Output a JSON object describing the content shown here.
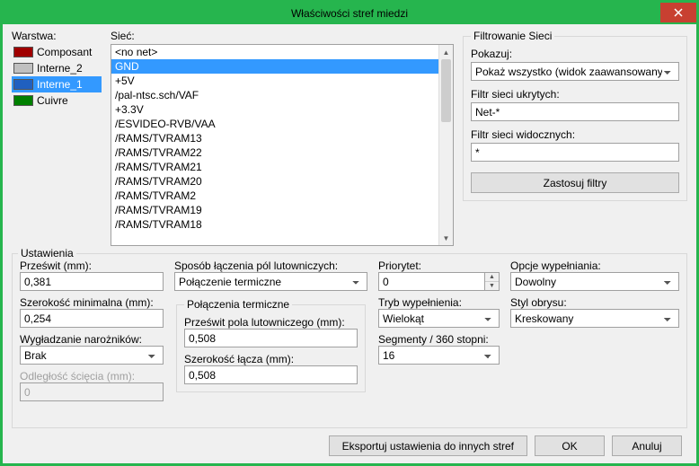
{
  "window": {
    "title": "Właściwości stref miedzi"
  },
  "layers": {
    "label": "Warstwa:",
    "items": [
      {
        "name": "Composant",
        "color": "#a00000",
        "selected": false
      },
      {
        "name": "Interne_2",
        "color": "#c0c0c0",
        "selected": false
      },
      {
        "name": "Interne_1",
        "color": "#2060c0",
        "selected": true
      },
      {
        "name": "Cuivre",
        "color": "#008000",
        "selected": false
      }
    ]
  },
  "nets": {
    "label": "Sieć:",
    "items": [
      "<no net>",
      "GND",
      "+5V",
      "/pal-ntsc.sch/VAF",
      "+3.3V",
      "/ESVIDEO-RVB/VAA",
      "/RAMS/TVRAM13",
      "/RAMS/TVRAM22",
      "/RAMS/TVRAM21",
      "/RAMS/TVRAM20",
      "/RAMS/TVRAM2",
      "/RAMS/TVRAM19",
      "/RAMS/TVRAM18"
    ],
    "selected_index": 1
  },
  "filter": {
    "legend": "Filtrowanie Sieci",
    "show_label": "Pokazuj:",
    "show_value": "Pokaż wszystko (widok zaawansowany)",
    "hidden_label": "Filtr sieci ukrytych:",
    "hidden_value": "Net-*",
    "visible_label": "Filtr sieci widocznych:",
    "visible_value": "*",
    "apply_label": "Zastosuj filtry"
  },
  "settings": {
    "legend": "Ustawienia",
    "clearance_label": "Prześwit (mm):",
    "clearance_value": "0,381",
    "minwidth_label": "Szerokość minimalna (mm):",
    "minwidth_value": "0,254",
    "smoothing_label": "Wygładzanie narożników:",
    "smoothing_value": "Brak",
    "chamfer_label": "Odległość ścięcia (mm):",
    "chamfer_value": "0",
    "padconn_label": "Sposób łączenia pól lutowniczych:",
    "padconn_value": "Połączenie termiczne",
    "thermal_legend": "Połączenia termiczne",
    "antipad_label": "Prześwit pola lutowniczego (mm):",
    "antipad_value": "0,508",
    "spoke_label": "Szerokość łącza (mm):",
    "spoke_value": "0,508",
    "priority_label": "Priorytet:",
    "priority_value": "0",
    "fillmode_label": "Tryb wypełnienia:",
    "fillmode_value": "Wielokąt",
    "segments_label": "Segmenty / 360 stopni:",
    "segments_value": "16",
    "fillopt_label": "Opcje wypełniania:",
    "fillopt_value": "Dowolny",
    "outline_label": "Styl obrysu:",
    "outline_value": "Kreskowany"
  },
  "footer": {
    "export_label": "Eksportuj ustawienia do innych stref",
    "ok_label": "OK",
    "cancel_label": "Anuluj"
  }
}
